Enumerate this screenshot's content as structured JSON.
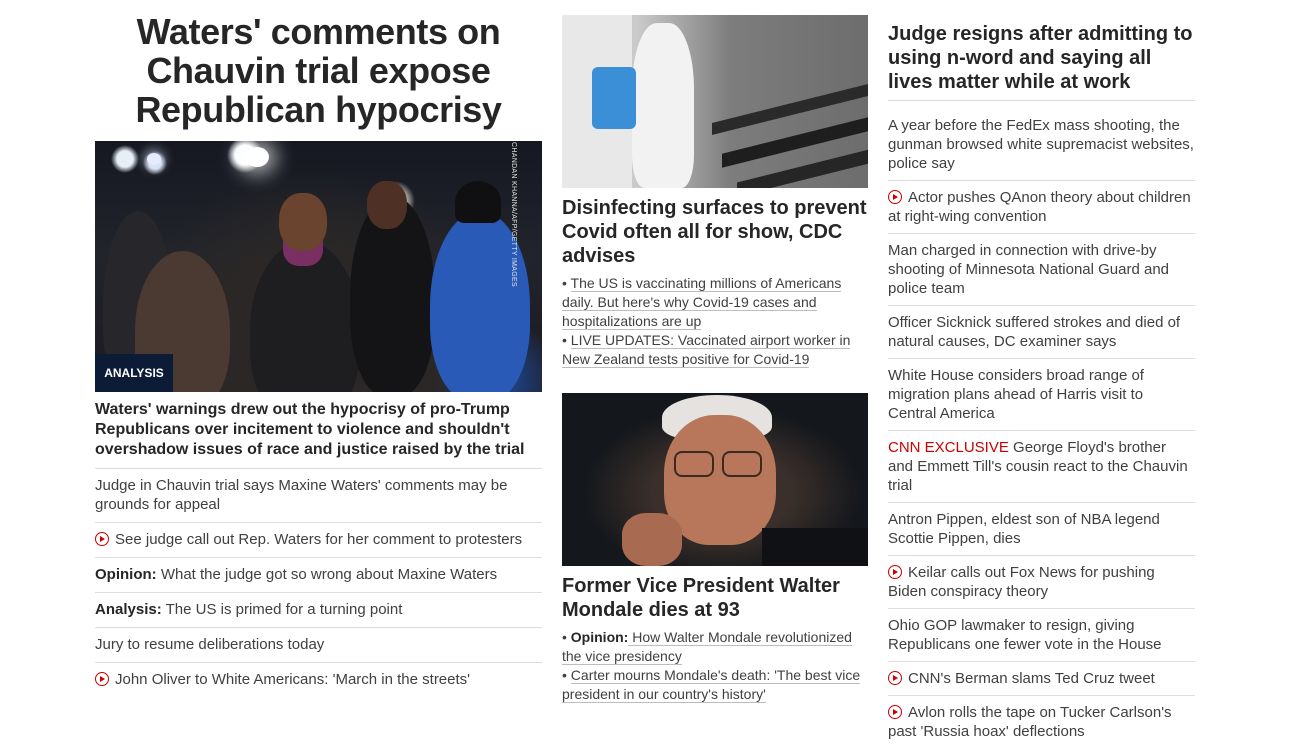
{
  "col1": {
    "headline": "Waters' comments on Chauvin trial expose Republican hypocrisy",
    "photo_credit": "CHANDAN KHANNA/AFP/GETTY IMAGES",
    "badge": "ANALYSIS",
    "dek": "Waters' warnings drew out the hypocrisy of pro-Trump Republicans over incitement to violence and shouldn't overshadow issues of race and justice raised by the trial",
    "items": [
      {
        "prefix": "",
        "text": "Judge in Chauvin trial says Maxine Waters' comments may be grounds for appeal",
        "video": false
      },
      {
        "prefix": "",
        "text": "See judge call out Rep. Waters for her comment to protesters",
        "video": true
      },
      {
        "prefix": "Opinion:",
        "text": " What the judge got so wrong about Maxine Waters",
        "video": false
      },
      {
        "prefix": "Analysis:",
        "text": " The US is primed for a turning point",
        "video": false
      },
      {
        "prefix": "",
        "text": "Jury to resume deliberations today",
        "video": false
      },
      {
        "prefix": "",
        "text": "John Oliver to White Americans: 'March in the streets'",
        "video": true
      }
    ]
  },
  "col2": {
    "story1": {
      "title": "Disinfecting surfaces to prevent Covid often all for show, CDC advises",
      "bullets": [
        {
          "prefix": "",
          "text": "The US is vaccinating millions of Americans daily. But here's why Covid-19 cases and hospitalizations are up"
        },
        {
          "prefix": "",
          "text": "LIVE UPDATES: Vaccinated airport worker in New Zealand tests positive for Covid-19"
        }
      ]
    },
    "story2": {
      "title": "Former Vice President Walter Mondale dies at 93",
      "bullets": [
        {
          "prefix": "Opinion:",
          "text": " How Walter Mondale revolutionized the vice presidency"
        },
        {
          "prefix": "",
          "text": "Carter mourns Mondale's death: 'The best vice president in our country's history'"
        }
      ]
    }
  },
  "col3": {
    "headline": "Judge resigns after admitting to using n-word and saying all lives matter while at work",
    "items": [
      {
        "label": "",
        "text": "A year before the FedEx mass shooting, the gunman browsed white supremacist websites, police say",
        "video": false
      },
      {
        "label": "",
        "text": "Actor pushes QAnon theory about children at right-wing convention",
        "video": true
      },
      {
        "label": "",
        "text": "Man charged in connection with drive-by shooting of Minnesota National Guard and police team",
        "video": false
      },
      {
        "label": "",
        "text": "Officer Sicknick suffered strokes and died of natural causes, DC examiner says",
        "video": false
      },
      {
        "label": "",
        "text": "White House considers broad range of migration plans ahead of Harris visit to Central America",
        "video": false
      },
      {
        "label": "CNN EXCLUSIVE",
        "text": " George Floyd's brother and Emmett Till's cousin react to the Chauvin trial",
        "video": false
      },
      {
        "label": "",
        "text": "Antron Pippen, eldest son of NBA legend Scottie Pippen, dies",
        "video": false
      },
      {
        "label": "",
        "text": "Keilar calls out Fox News for pushing Biden conspiracy theory",
        "video": true
      },
      {
        "label": "",
        "text": "Ohio GOP lawmaker to resign, giving Republicans one fewer vote in the House",
        "video": false
      },
      {
        "label": "",
        "text": "CNN's Berman slams Ted Cruz tweet",
        "video": true
      },
      {
        "label": "",
        "text": "Avlon rolls the tape on Tucker Carlson's past 'Russia hoax' deflections",
        "video": true
      }
    ]
  },
  "colors": {
    "accent_red": "#cc0000",
    "badge_bg": "#0c1b36",
    "divider": "#dedede"
  }
}
